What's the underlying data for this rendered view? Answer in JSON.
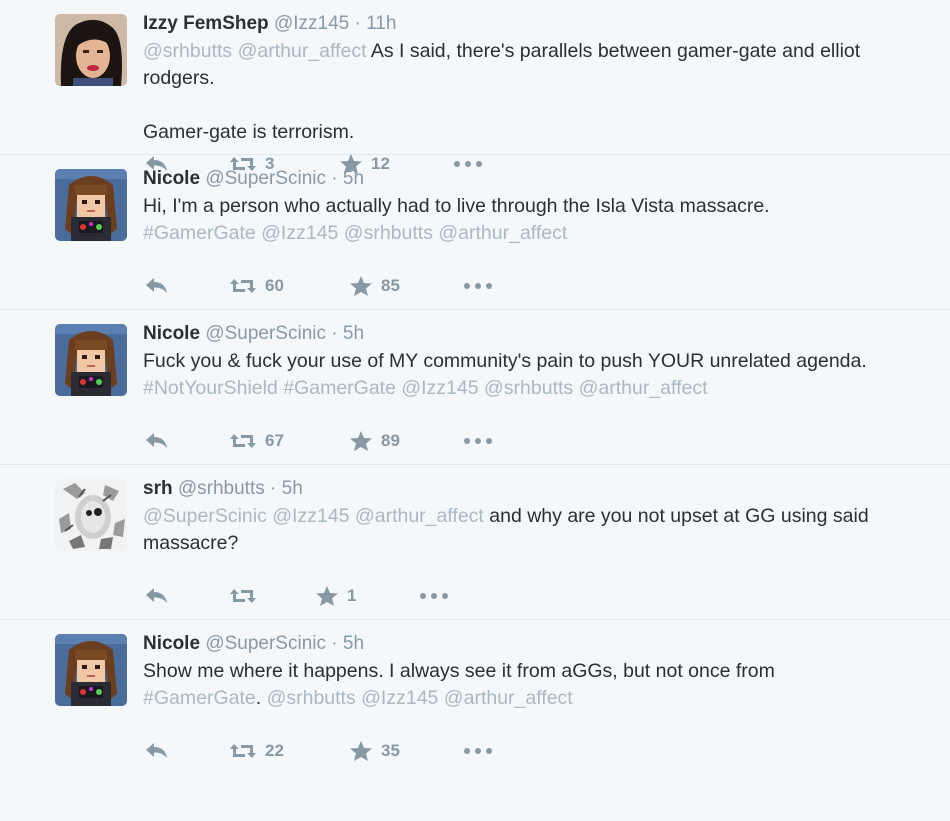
{
  "colors": {
    "background": "#f5f8fa",
    "name": "#292f33",
    "muted": "#8899a6",
    "mention": "#aab8c2",
    "divider": "#e1e8ed"
  },
  "icons": {
    "reply": "reply-icon",
    "retweet": "retweet-icon",
    "favorite": "star-icon",
    "more": "more-icon"
  },
  "tweets": [
    {
      "name": "Izzy FemShep",
      "handle": "@Izz145",
      "dot": "·",
      "time": "11h",
      "lines": [
        {
          "mentions": "@srhbutts @arthur_affect",
          "text": " As I said, there's parallels between gamer-gate and elliot rodgers."
        },
        {
          "text": "Gamer-gate is terrorism."
        }
      ],
      "retweets": "3",
      "favorites": "12"
    },
    {
      "name": "Nicole",
      "handle": "@SuperScinic",
      "dot": "·",
      "time": "5h",
      "text": "Hi, I'm a person who actually had to live through the Isla Vista massacre.",
      "mentions": "#GamerGate @Izz145 @srhbutts @arthur_affect",
      "retweets": "60",
      "favorites": "85"
    },
    {
      "name": "Nicole",
      "handle": "@SuperScinic",
      "dot": "·",
      "time": "5h",
      "text": "Fuck you & fuck your use of MY community's pain to push YOUR unrelated agenda.",
      "mentions": "#NotYourShield #GamerGate @Izz145 @srhbutts @arthur_affect",
      "retweets": "67",
      "favorites": "89"
    },
    {
      "name": "srh",
      "handle": "@srhbutts",
      "dot": "·",
      "time": "5h",
      "mentions": "@SuperScinic @Izz145 @arthur_affect",
      "text": " and why are you not upset at GG using said massacre?",
      "retweets": "",
      "favorites": "1"
    },
    {
      "name": "Nicole",
      "handle": "@SuperScinic",
      "dot": "·",
      "time": "5h",
      "text": "Show me where it happens. I always see it from aGGs, but not once from",
      "hashtag": "#GamerGate",
      "text2": ".",
      "mentions": "@srhbutts @Izz145 @arthur_affect",
      "retweets": "22",
      "favorites": "35"
    }
  ]
}
